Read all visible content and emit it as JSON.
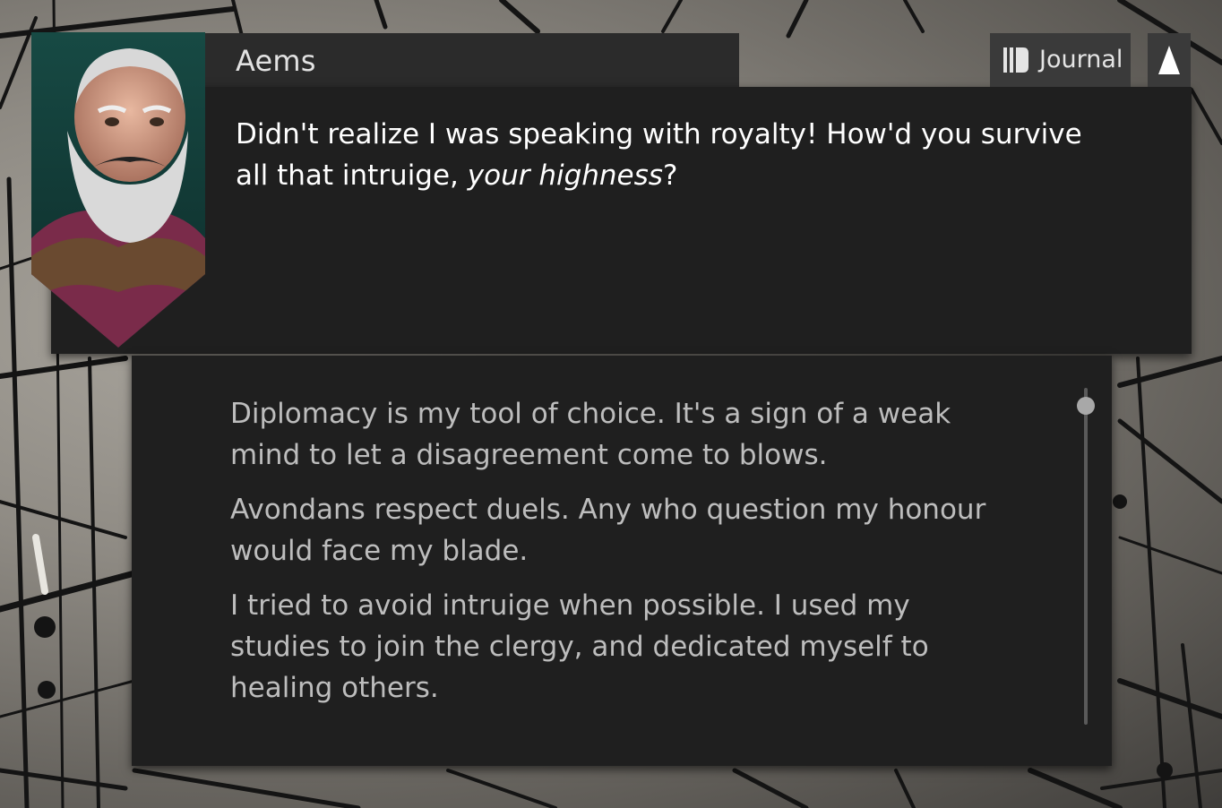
{
  "speaker": {
    "name": "Aems",
    "line_before_emphasis": "Didn't realize I was speaking with royalty! How'd you survive all that intruige, ",
    "line_emphasis": "your highness",
    "line_after_emphasis": "?"
  },
  "toolbar": {
    "journal_label": "Journal",
    "journal_icon": "journal-books-icon",
    "collapse_icon": "triangle-up-icon"
  },
  "responses": [
    "Diplomacy is my tool of choice. It's a sign of a weak mind to let a disagreement come to blows.",
    "Avondans respect duels. Any who question my honour would face my blade.",
    "I tried to avoid intruige when possible. I used my studies to join the clergy, and dedicated myself to healing others."
  ],
  "scroll": {
    "position": 0
  },
  "colors": {
    "panel_bg": "#1f1f1f",
    "name_tab_bg": "#2b2b2b",
    "button_bg": "#3a3a3a",
    "dialogue_text": "#ffffff",
    "response_text": "#bdbdbd"
  }
}
